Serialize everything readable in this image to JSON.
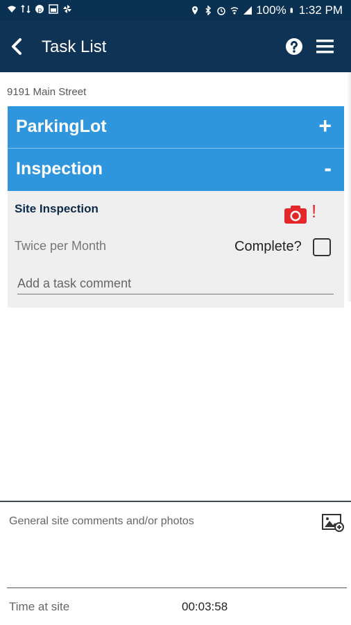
{
  "status_bar": {
    "battery": "100%",
    "time": "1:32 PM"
  },
  "app_bar": {
    "title": "Task List",
    "icons": [
      "back-arrow-icon",
      "help-icon",
      "hamburger-menu-icon"
    ]
  },
  "address": "9191 Main Street",
  "sections": [
    {
      "label": "ParkingLot",
      "toggle": "+"
    },
    {
      "label": "Inspection",
      "toggle": "-"
    }
  ],
  "task": {
    "name": "Site Inspection",
    "frequency": "Twice per Month",
    "complete_label": "Complete?",
    "complete_checked": false,
    "comment_placeholder": "Add a task comment",
    "photo_alert": "!"
  },
  "footer": {
    "general_comments": "General site comments and/or photos",
    "time_label": "Time at site",
    "time_value": "00:03:58"
  },
  "colors": {
    "app_bar": "#0e3354",
    "section": "#2f96dd",
    "alert": "#e5262a"
  }
}
